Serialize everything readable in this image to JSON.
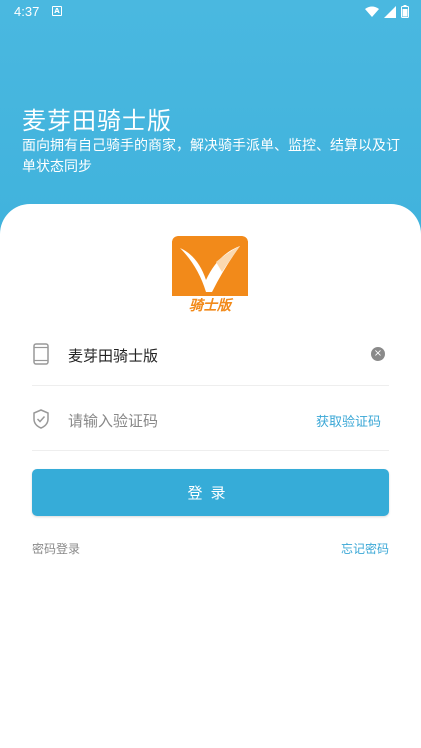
{
  "status_bar": {
    "time": "4:37",
    "notification_glyph": "A"
  },
  "header": {
    "title": "麦芽田骑士版",
    "subtitle": "面向拥有自己骑手的商家，解决骑手派单、监控、结算以及订单状态同步"
  },
  "logo": {
    "text": "骑士版"
  },
  "form": {
    "phone_value": "麦芽田骑士版",
    "code_placeholder": "请输入验证码",
    "get_code_label": "获取验证码",
    "clear_glyph": "×"
  },
  "actions": {
    "login_label": "登录",
    "password_login_label": "密码登录",
    "forgot_password_label": "忘记密码"
  },
  "colors": {
    "brand_blue": "#3fb2dc",
    "logo_orange": "#f28a1a"
  }
}
